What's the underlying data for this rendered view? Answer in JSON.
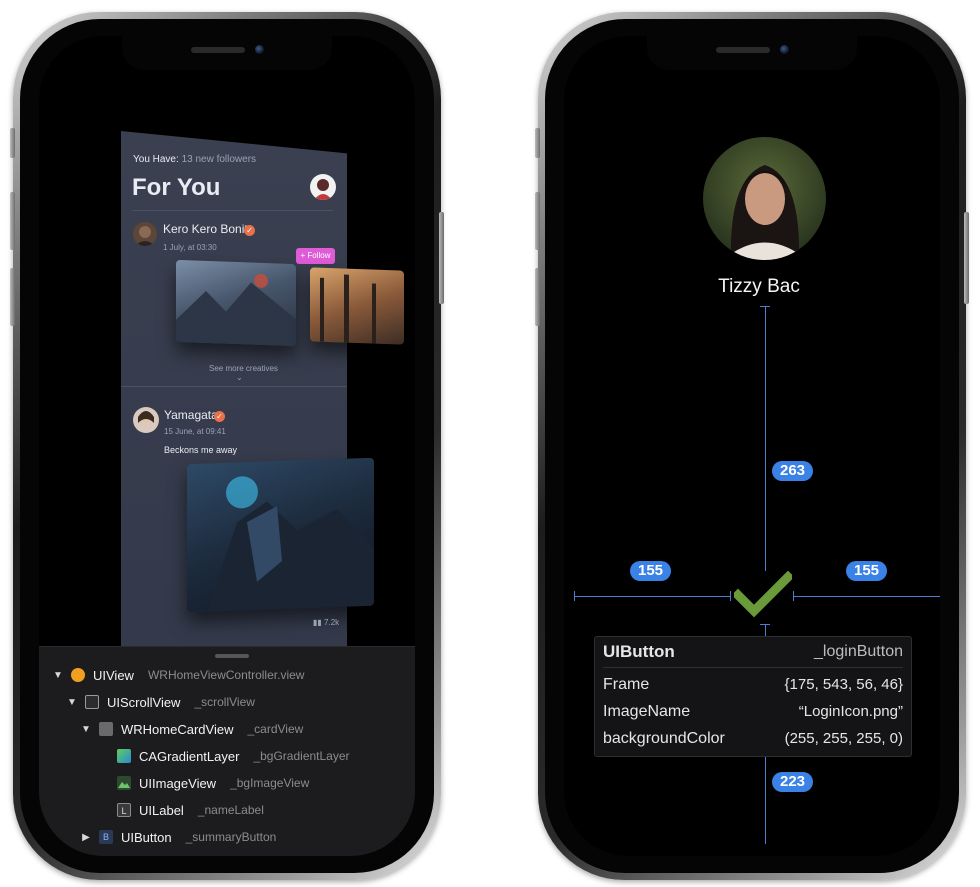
{
  "left_phone": {
    "feed": {
      "you_have_label": "You Have:",
      "followers_text": "13 new followers",
      "title": "For You",
      "posts": [
        {
          "author": "Kero Kero Bonito",
          "date": "1 July, at 03:30",
          "follow_label": "+ Follow",
          "see_more": "See more creatives"
        },
        {
          "author": "Yamagata",
          "date": "15 June, at 09:41",
          "text": "Beckons me away",
          "stat": "7.2k"
        }
      ]
    },
    "hierarchy": [
      {
        "name": "UIView",
        "sub": "WRHomeViewController.view",
        "icon": "view-icon"
      },
      {
        "name": "UIScrollView",
        "sub": "_scrollView",
        "icon": "scrollview-icon"
      },
      {
        "name": "WRHomeCardView",
        "sub": "_cardView",
        "icon": "cardview-icon"
      },
      {
        "name": "CAGradientLayer",
        "sub": "_bgGradientLayer",
        "icon": "layer-icon"
      },
      {
        "name": "UIImageView",
        "sub": "_bgImageView",
        "icon": "imageview-icon"
      },
      {
        "name": "UILabel",
        "sub": "_nameLabel",
        "icon": "label-icon",
        "glyph": "L"
      },
      {
        "name": "UIButton",
        "sub": "_summaryButton",
        "icon": "button-icon",
        "glyph": "B"
      }
    ]
  },
  "right_phone": {
    "profile_name": "Tizzy Bac",
    "measurements": {
      "top": "263",
      "left": "155",
      "right": "155",
      "bottom": "223"
    },
    "inspector": {
      "class_name": "UIButton",
      "variable": "_loginButton",
      "rows": [
        {
          "key": "Frame",
          "value": "{175, 543, 56, 46}"
        },
        {
          "key": "ImageName",
          "value": "“LoginIcon.png”"
        },
        {
          "key": "backgroundColor",
          "value": "(255, 255, 255, 0)"
        }
      ]
    }
  },
  "colors": {
    "accent_blue": "#3b82e6",
    "checkmark_green": "#6a9a3a",
    "follow_pink": "#e05bd8",
    "verified_orange": "#e8704a"
  }
}
